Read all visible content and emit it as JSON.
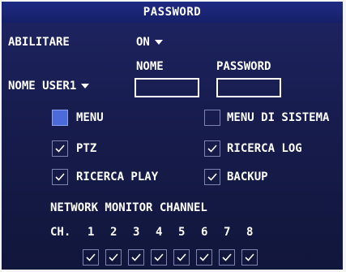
{
  "title": "PASSWORD",
  "abilitare": {
    "label": "ABILITARE",
    "value": "ON"
  },
  "user_select": {
    "value": "NOME USER1"
  },
  "fields": {
    "nome_label": "NOME",
    "password_label": "PASSWORD",
    "nome_value": "",
    "password_value": ""
  },
  "permissions": [
    {
      "label": "MENU",
      "checked": false,
      "highlighted": true
    },
    {
      "label": "MENU DI SISTEMA",
      "checked": false,
      "highlighted": false
    },
    {
      "label": "PTZ",
      "checked": true,
      "highlighted": false
    },
    {
      "label": "RICERCA LOG",
      "checked": true,
      "highlighted": false
    },
    {
      "label": "RICERCA PLAY",
      "checked": true,
      "highlighted": false
    },
    {
      "label": "BACKUP",
      "checked": true,
      "highlighted": false
    }
  ],
  "network": {
    "title": "NETWORK MONITOR CHANNEL",
    "ch_label": "CH.",
    "channels": [
      "1",
      "2",
      "3",
      "4",
      "5",
      "6",
      "7",
      "8"
    ],
    "checked": [
      true,
      true,
      true,
      true,
      true,
      true,
      true,
      true
    ]
  },
  "colors": {
    "background": "#171c4d",
    "titlebar": "#1e2a83",
    "highlight": "#4a6bd8",
    "text": "#ffffff"
  }
}
